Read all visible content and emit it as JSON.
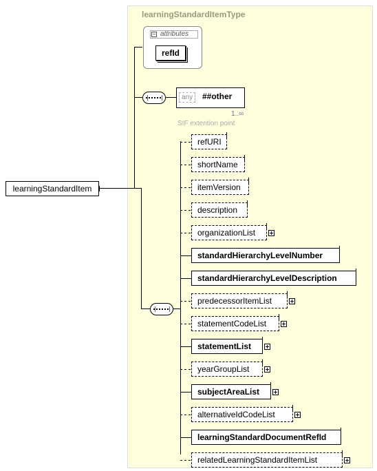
{
  "typeName": "learningStandardItemType",
  "root": "learningStandardItem",
  "attributesLabel": "attributes",
  "refId": "refId",
  "any": {
    "tag": "any",
    "ns": "##other",
    "occurs": "1..∞",
    "note": "SIF extention point"
  },
  "elements": [
    {
      "name": "refURI",
      "optional": true,
      "expand": false,
      "bold": false
    },
    {
      "name": "shortName",
      "optional": true,
      "expand": false,
      "bold": false
    },
    {
      "name": "itemVersion",
      "optional": true,
      "expand": false,
      "bold": false
    },
    {
      "name": "description",
      "optional": true,
      "expand": false,
      "bold": false
    },
    {
      "name": "organizationList",
      "optional": true,
      "expand": true,
      "bold": false
    },
    {
      "name": "standardHierarchyLevelNumber",
      "optional": false,
      "expand": false,
      "bold": true
    },
    {
      "name": "standardHierarchyLevelDescription",
      "optional": false,
      "expand": false,
      "bold": true
    },
    {
      "name": "predecessorItemList",
      "optional": true,
      "expand": true,
      "bold": false
    },
    {
      "name": "statementCodeList",
      "optional": true,
      "expand": true,
      "bold": false
    },
    {
      "name": "statementList",
      "optional": false,
      "expand": true,
      "bold": true
    },
    {
      "name": "yearGroupList",
      "optional": true,
      "expand": true,
      "bold": false
    },
    {
      "name": "subjectAreaList",
      "optional": false,
      "expand": true,
      "bold": true
    },
    {
      "name": "alternativeIdCodeList",
      "optional": true,
      "expand": true,
      "bold": false
    },
    {
      "name": "learningStandardDocumentRefId",
      "optional": false,
      "expand": false,
      "bold": true
    },
    {
      "name": "relatedLearningStandardItemList",
      "optional": true,
      "expand": true,
      "bold": false
    }
  ]
}
